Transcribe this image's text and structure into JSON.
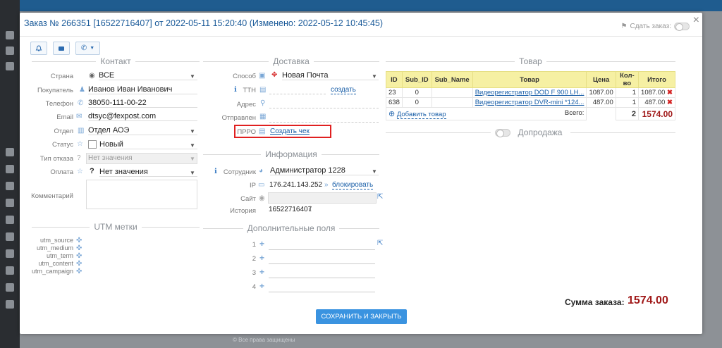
{
  "modal": {
    "title": "Заказ № 266351 [16522716407] от 2022-05-11 15:20:40 (Изменено: 2022-05-12 10:45:45)",
    "sdat_label": "Сдать заказ:",
    "close": "×"
  },
  "toolbar": {
    "bell": "bell-icon",
    "card": "card-icon",
    "phone": "phone-icon"
  },
  "contact": {
    "title": "Контакт",
    "country_label": "Страна",
    "country_value": "ВСЕ",
    "buyer_label": "Покупатель",
    "buyer_value": "Иванов Иван Иванович",
    "phone_label": "Телефон",
    "phone_value": "38050-111-00-22",
    "email_label": "Email",
    "email_value": "dtsyc@fexpost.com",
    "dept_label": "Отдел",
    "dept_value": "Отдел АОЭ",
    "status_label": "Статус",
    "status_value": "Новый",
    "refuse_label": "Тип отказа",
    "refuse_value": "Нет значения",
    "pay_label": "Оплата",
    "pay_value": "Нет значения",
    "comment_label": "Комментарий"
  },
  "utm": {
    "title": "UTM метки",
    "items": [
      "utm_source",
      "utm_medium",
      "utm_term",
      "utm_content",
      "utm_campaign"
    ]
  },
  "delivery": {
    "title": "Доставка",
    "method_label": "Способ",
    "method_value": "Новая Почта",
    "ttn_label": "ТТН",
    "ttn_action": "создать",
    "address_label": "Адрес",
    "sent_label": "Отправлен",
    "prro_label": "ПРРО",
    "prro_action": "Создать чек"
  },
  "info": {
    "title": "Информация",
    "employee_label": "Сотрудник",
    "employee_value": "Администратор 1228",
    "ip_label": "IP",
    "ip_value": "176.241.143.252",
    "ip_action": "блокировать",
    "site_label": "Сайт",
    "history_label": "История",
    "history_value": "16522716407"
  },
  "extra": {
    "title": "Дополнительные поля",
    "rows": [
      "1",
      "2",
      "3",
      "4"
    ]
  },
  "goods": {
    "title": "Товар",
    "headers": [
      "ID",
      "Sub_ID",
      "Sub_Name",
      "Товар",
      "Цена",
      "Кол-во",
      "Итого"
    ],
    "rows": [
      {
        "id": "23",
        "sub_id": "0",
        "sub_name": "",
        "name": "Видеорегистратор DOD F 900 LH...",
        "price": "1087.00",
        "qty": "1",
        "total": "1087.00"
      },
      {
        "id": "638",
        "sub_id": "0",
        "sub_name": "",
        "name": "Видеорегистратор DVR-mini *124...",
        "price": "487.00",
        "qty": "1",
        "total": "487.00"
      }
    ],
    "add_label": "Добавить товар",
    "sum_label": "Всего:",
    "sum_qty": "2",
    "sum_total": "1574.00"
  },
  "upsell": {
    "title": "Допродажа"
  },
  "order_sum": {
    "label": "Сумма заказа:",
    "value": "1574.00"
  },
  "save_button": "СОХРАНИТЬ И ЗАКРЫТЬ",
  "background": {
    "footer_text": "© Все права защищены"
  },
  "colors": {
    "accent": "#3a93e0",
    "title": "#1a5a99",
    "highlight": "#e02020",
    "table_header": "#f6f0a3",
    "sum": "#a01818"
  }
}
